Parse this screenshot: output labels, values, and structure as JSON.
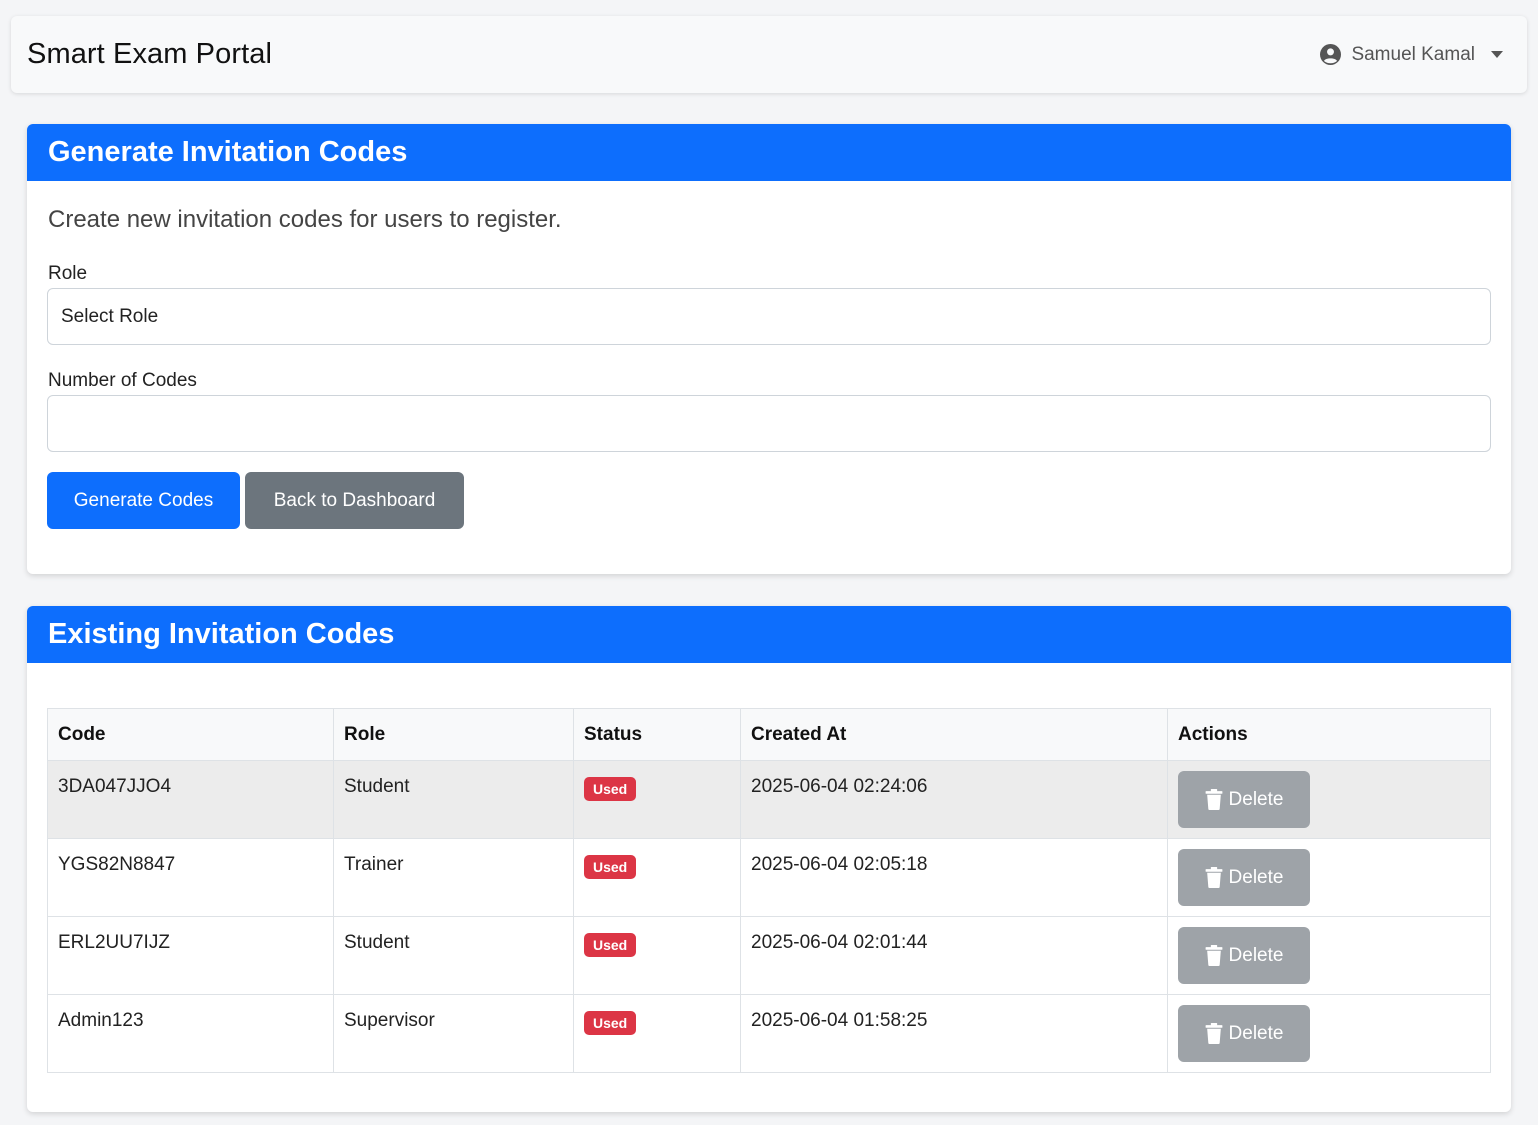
{
  "navbar": {
    "brand": "Smart Exam Portal",
    "user_name": "Samuel Kamal"
  },
  "generate": {
    "title": "Generate Invitation Codes",
    "lead": "Create new invitation codes for users to register.",
    "role_label": "Role",
    "role_value": "Select Role",
    "count_label": "Number of Codes",
    "count_value": "",
    "generate_button": "Generate Codes",
    "back_button": "Back to Dashboard"
  },
  "existing": {
    "title": "Existing Invitation Codes",
    "columns": [
      "Code",
      "Role",
      "Status",
      "Created At",
      "Actions"
    ],
    "rows": [
      {
        "code": "3DA047JJO4",
        "role": "Student",
        "status": "Used",
        "created_at": "2025-06-04 02:24:06",
        "action": "Delete"
      },
      {
        "code": "YGS82N8847",
        "role": "Trainer",
        "status": "Used",
        "created_at": "2025-06-04 02:05:18",
        "action": "Delete"
      },
      {
        "code": "ERL2UU7IJZ",
        "role": "Student",
        "status": "Used",
        "created_at": "2025-06-04 02:01:44",
        "action": "Delete"
      },
      {
        "code": "Admin123",
        "role": "Supervisor",
        "status": "Used",
        "created_at": "2025-06-04 01:58:25",
        "action": "Delete"
      }
    ]
  },
  "colors": {
    "primary": "#0d6efd",
    "secondary": "#6c757d",
    "danger": "#dc3545",
    "disabled_button": "#9ea3a8"
  },
  "icons": {
    "user": "user-circle-icon",
    "dropdown": "caret-down-icon",
    "delete": "trash-icon"
  }
}
